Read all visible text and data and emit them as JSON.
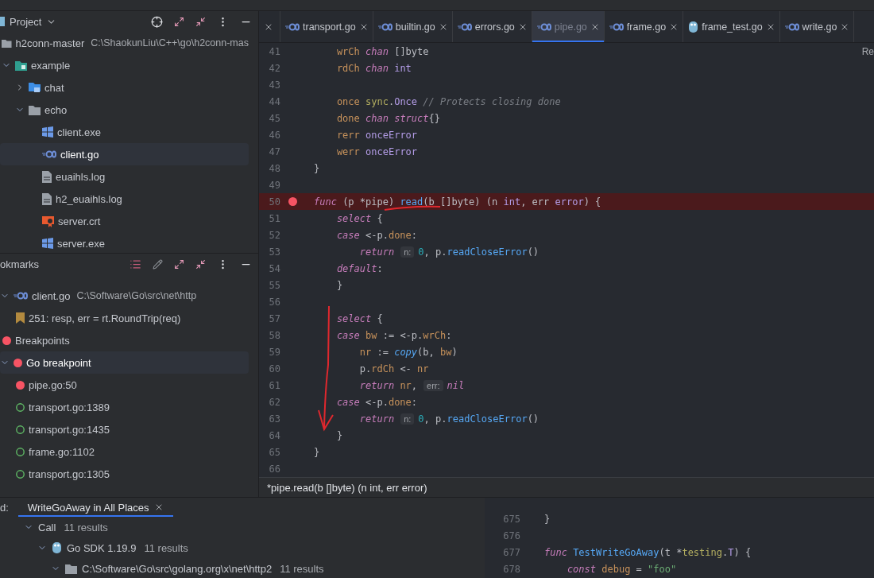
{
  "project_panel": {
    "title": "Project",
    "tree": [
      {
        "label": "h2conn-master",
        "path": "C:\\ShaokunLiu\\C++\\go\\h2conn-mas",
        "kind": "folder",
        "selected": false,
        "children": [
          {
            "label": "example",
            "kind": "module",
            "expanded": true,
            "selected": false,
            "children": [
              {
                "label": "chat",
                "kind": "package",
                "expanded": false,
                "selected": false
              },
              {
                "label": "echo",
                "kind": "folder",
                "expanded": true,
                "selected": false,
                "children": [
                  {
                    "label": "client.exe",
                    "kind": "exe",
                    "selected": false
                  },
                  {
                    "label": "client.go",
                    "kind": "go",
                    "selected": true
                  },
                  {
                    "label": "euaihls.log",
                    "kind": "log",
                    "selected": false
                  },
                  {
                    "label": "h2_euaihls.log",
                    "kind": "log",
                    "selected": false
                  },
                  {
                    "label": "server.crt",
                    "kind": "cert",
                    "selected": false
                  },
                  {
                    "label": "server.exe",
                    "kind": "exe",
                    "selected": false
                  }
                ]
              }
            ]
          }
        ]
      }
    ]
  },
  "bookmarks_panel": {
    "title": "okmarks",
    "tree": [
      {
        "label": "client.go",
        "path": "C:\\Software\\Go\\src\\net\\http",
        "kind": "go",
        "expanded": true,
        "selected": false,
        "children": [
          {
            "label": "251: resp, err = rt.RoundTrip(req)",
            "kind": "bookmark",
            "selected": false
          }
        ]
      },
      {
        "label": "Breakpoints",
        "kind": "breakpoint",
        "enabled": true,
        "selected": false
      },
      {
        "label": "Go breakpoint",
        "kind": "breakpoint",
        "enabled": true,
        "expanded": true,
        "selected": true,
        "children": [
          {
            "label": "pipe.go:50",
            "kind": "breakpoint",
            "enabled": true,
            "selected": false
          },
          {
            "label": "transport.go:1389",
            "kind": "breakpoint",
            "enabled": false,
            "selected": false
          },
          {
            "label": "transport.go:1435",
            "kind": "breakpoint",
            "enabled": false,
            "selected": false
          },
          {
            "label": "frame.go:1102",
            "kind": "breakpoint",
            "enabled": false,
            "selected": false
          },
          {
            "label": "transport.go:1305",
            "kind": "breakpoint",
            "enabled": false,
            "selected": false
          }
        ]
      }
    ]
  },
  "editor": {
    "tabs": [
      {
        "label": "transport.go",
        "kind": "go",
        "selected": false
      },
      {
        "label": "builtin.go",
        "kind": "go",
        "selected": false
      },
      {
        "label": "errors.go",
        "kind": "go",
        "selected": false
      },
      {
        "label": "pipe.go",
        "kind": "go",
        "selected": true
      },
      {
        "label": "frame.go",
        "kind": "go",
        "selected": false
      },
      {
        "label": "frame_test.go",
        "kind": "gopher",
        "selected": false
      },
      {
        "label": "write.go",
        "kind": "go",
        "selected": false
      }
    ],
    "reader_mode": "Re",
    "lines": [
      {
        "number": "41",
        "breakpoint": false,
        "tokens": [
          {
            "text": "    wrCh ",
            "kind": "field"
          },
          {
            "text": "chan",
            "kind": "keyword"
          },
          {
            "text": " []byte",
            "kind": "plain"
          }
        ]
      },
      {
        "number": "42",
        "breakpoint": false,
        "tokens": [
          {
            "text": "    rdCh ",
            "kind": "field"
          },
          {
            "text": "chan",
            "kind": "keyword"
          },
          {
            "text": " int",
            "kind": "type"
          }
        ]
      },
      {
        "number": "43",
        "breakpoint": false
      },
      {
        "number": "44",
        "breakpoint": false,
        "tokens": [
          {
            "text": "    once ",
            "kind": "field"
          },
          {
            "text": "sync",
            "kind": "package"
          },
          {
            "text": ".",
            "kind": "plain"
          },
          {
            "text": "Once",
            "kind": "type"
          },
          {
            "text": " // Protects closing ",
            "kind": "comment"
          },
          {
            "text": "done",
            "kind": "comment"
          }
        ]
      },
      {
        "number": "45",
        "breakpoint": false,
        "tokens": [
          {
            "text": "    done ",
            "kind": "field"
          },
          {
            "text": "chan struct",
            "kind": "keyword"
          },
          {
            "text": "{}",
            "kind": "plain"
          }
        ]
      },
      {
        "number": "46",
        "breakpoint": false,
        "tokens": [
          {
            "text": "    rerr ",
            "kind": "field"
          },
          {
            "text": "onceError",
            "kind": "type"
          }
        ]
      },
      {
        "number": "47",
        "breakpoint": false,
        "tokens": [
          {
            "text": "    werr ",
            "kind": "field"
          },
          {
            "text": "onceError",
            "kind": "type"
          }
        ]
      },
      {
        "number": "48",
        "breakpoint": false,
        "tokens": [
          {
            "text": "}",
            "kind": "plain"
          }
        ]
      },
      {
        "number": "49",
        "breakpoint": false
      },
      {
        "number": "50",
        "breakpoint": true,
        "tokens": [
          {
            "text": "func",
            "kind": "keyword"
          },
          {
            "text": " (p *pipe) ",
            "kind": "plain"
          },
          {
            "text": "read",
            "kind": "func"
          },
          {
            "text": "(b []byte) (n ",
            "kind": "plain"
          },
          {
            "text": "int",
            "kind": "type"
          },
          {
            "text": ", err ",
            "kind": "plain"
          },
          {
            "text": "error",
            "kind": "type"
          },
          {
            "text": ") {",
            "kind": "plain"
          }
        ]
      },
      {
        "number": "51",
        "breakpoint": false,
        "tokens": [
          {
            "text": "    select",
            "kind": "keyword"
          },
          {
            "text": " {",
            "kind": "plain"
          }
        ]
      },
      {
        "number": "52",
        "breakpoint": false,
        "tokens": [
          {
            "text": "    case",
            "kind": "keyword"
          },
          {
            "text": " <-p.",
            "kind": "plain"
          },
          {
            "text": "done",
            "kind": "field"
          },
          {
            "text": ":",
            "kind": "plain"
          }
        ]
      },
      {
        "number": "53",
        "breakpoint": false,
        "tokens": [
          {
            "text": "        return",
            "kind": "keyword"
          },
          {
            "text": "n:",
            "kind": "hint"
          },
          {
            "text": "0",
            "kind": "number"
          },
          {
            "text": ", p.",
            "kind": "plain"
          },
          {
            "text": "readCloseError",
            "kind": "func"
          },
          {
            "text": "()",
            "kind": "plain"
          }
        ]
      },
      {
        "number": "54",
        "breakpoint": false,
        "tokens": [
          {
            "text": "    default",
            "kind": "keyword"
          },
          {
            "text": ":",
            "kind": "plain"
          }
        ]
      },
      {
        "number": "55",
        "breakpoint": false,
        "tokens": [
          {
            "text": "    }",
            "kind": "plain"
          }
        ]
      },
      {
        "number": "56",
        "breakpoint": false
      },
      {
        "number": "57",
        "breakpoint": false,
        "tokens": [
          {
            "text": "    select",
            "kind": "keyword"
          },
          {
            "text": " {",
            "kind": "plain"
          }
        ]
      },
      {
        "number": "58",
        "breakpoint": false,
        "tokens": [
          {
            "text": "    case",
            "kind": "keyword"
          },
          {
            "text": " bw",
            "kind": "field"
          },
          {
            "text": " := <-p.",
            "kind": "plain"
          },
          {
            "text": "wrCh",
            "kind": "field"
          },
          {
            "text": ":",
            "kind": "plain"
          }
        ]
      },
      {
        "number": "59",
        "breakpoint": false,
        "tokens": [
          {
            "text": "        nr",
            "kind": "field"
          },
          {
            "text": " := ",
            "kind": "plain"
          },
          {
            "text": "copy",
            "kind": "builtin"
          },
          {
            "text": "(b, ",
            "kind": "plain"
          },
          {
            "text": "bw",
            "kind": "field"
          },
          {
            "text": ")",
            "kind": "plain"
          }
        ]
      },
      {
        "number": "60",
        "breakpoint": false,
        "tokens": [
          {
            "text": "        p.",
            "kind": "plain"
          },
          {
            "text": "rdCh",
            "kind": "field"
          },
          {
            "text": " <- ",
            "kind": "plain"
          },
          {
            "text": "nr",
            "kind": "field"
          }
        ]
      },
      {
        "number": "61",
        "breakpoint": false,
        "tokens": [
          {
            "text": "        return",
            "kind": "keyword"
          },
          {
            "text": " nr",
            "kind": "field"
          },
          {
            "text": ",",
            "kind": "plain"
          },
          {
            "text": "err:",
            "kind": "hint"
          },
          {
            "text": "nil",
            "kind": "keyword"
          }
        ]
      },
      {
        "number": "62",
        "breakpoint": false,
        "tokens": [
          {
            "text": "    case",
            "kind": "keyword"
          },
          {
            "text": " <-p.",
            "kind": "plain"
          },
          {
            "text": "done",
            "kind": "field"
          },
          {
            "text": ":",
            "kind": "plain"
          }
        ]
      },
      {
        "number": "63",
        "breakpoint": false,
        "tokens": [
          {
            "text": "        return",
            "kind": "keyword"
          },
          {
            "text": "n:",
            "kind": "hint"
          },
          {
            "text": "0",
            "kind": "number"
          },
          {
            "text": ", p.",
            "kind": "plain"
          },
          {
            "text": "readCloseError",
            "kind": "func"
          },
          {
            "text": "()",
            "kind": "plain"
          }
        ]
      },
      {
        "number": "64",
        "breakpoint": false,
        "tokens": [
          {
            "text": "    }",
            "kind": "plain"
          }
        ]
      },
      {
        "number": "65",
        "breakpoint": false,
        "tokens": [
          {
            "text": "}",
            "kind": "plain"
          }
        ]
      },
      {
        "number": "66",
        "breakpoint": false
      }
    ],
    "tooltip": "*pipe.read(b []byte) (n int, err error)"
  },
  "find_panel": {
    "label": "d:",
    "tabs": [
      {
        "label": "WriteGoAway in All Places",
        "selected": true
      }
    ],
    "tree": [
      {
        "label": "Call",
        "count": "11 results",
        "expanded": true,
        "children": [
          {
            "label": "Go SDK 1.19.9",
            "count": "11 results",
            "kind": "gopher",
            "expanded": true,
            "children": [
              {
                "label": "C:\\Software\\Go\\src\\golang.org\\x\\net\\http2",
                "count": "11 results",
                "kind": "folder",
                "expanded": true
              }
            ]
          }
        ]
      }
    ],
    "preview": [
      {
        "number": "675",
        "tokens": [
          {
            "text": "}",
            "kind": "plain"
          }
        ]
      },
      {
        "number": "676"
      },
      {
        "number": "677",
        "tokens": [
          {
            "text": "func ",
            "kind": "keyword"
          },
          {
            "text": "TestWriteGoAway",
            "kind": "func"
          },
          {
            "text": "(t *",
            "kind": "plain"
          },
          {
            "text": "testing",
            "kind": "package"
          },
          {
            "text": ".",
            "kind": "plain"
          },
          {
            "text": "T",
            "kind": "type"
          },
          {
            "text": ") {",
            "kind": "plain"
          }
        ]
      },
      {
        "number": "678",
        "tokens": [
          {
            "text": "    const ",
            "kind": "keyword"
          },
          {
            "text": "debug",
            "kind": "field"
          },
          {
            "text": " = ",
            "kind": "plain"
          },
          {
            "text": "\"foo\"",
            "kind": "string"
          }
        ]
      }
    ]
  }
}
